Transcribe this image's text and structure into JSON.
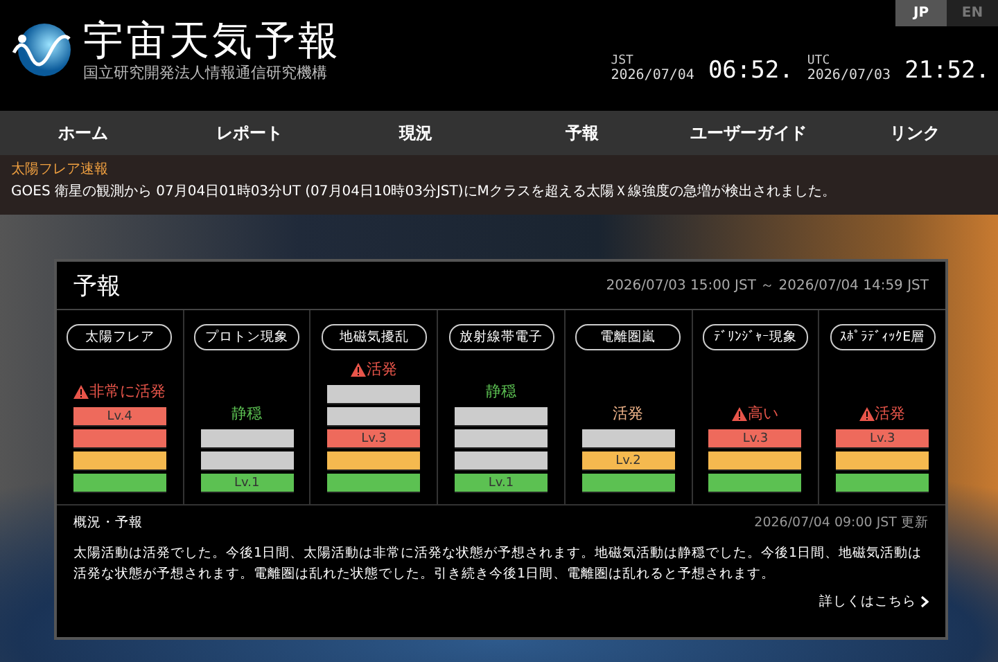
{
  "header": {
    "title": "宇宙天気予報",
    "subtitle": "国立研究開発法人情報通信研究機構",
    "languages": [
      {
        "label": "JP",
        "selected": true
      },
      {
        "label": "EN",
        "selected": false
      }
    ],
    "clocks": [
      {
        "zone": "JST",
        "date": "2026/07/04",
        "time": "06:52."
      },
      {
        "zone": "UTC",
        "date": "2026/07/03",
        "time": "21:52."
      }
    ]
  },
  "nav": [
    "ホーム",
    "レポート",
    "現況",
    "予報",
    "ユーザーガイド",
    "リンク"
  ],
  "alert": {
    "title": "太陽フレア速報",
    "message": "GOES 衛星の観測から 07月04日01時03分UT (07月04日10時03分JST)にMクラスを超える太陽Ｘ線強度の急増が検出されました。"
  },
  "forecast": {
    "title": "予報",
    "period": "2026/07/03 15:00 JST ～ 2026/07/04 14:59 JST",
    "categories": [
      {
        "name": "太陽フレア",
        "status": "非常に活発",
        "warning": true,
        "color": "#e8554a",
        "segments": [
          {
            "color": "#ee6a5c",
            "label": "Lv.4"
          },
          {
            "color": "#ee6a5c"
          },
          {
            "color": "#f5b94f"
          },
          {
            "color": "#5cc152"
          }
        ]
      },
      {
        "name": "プロトン現象",
        "status": "静穏",
        "warning": false,
        "color": "#5cc152",
        "segments": [
          {
            "color": "#cccccc"
          },
          {
            "color": "#cccccc"
          },
          {
            "color": "#5cc152",
            "label": "Lv.1"
          }
        ]
      },
      {
        "name": "地磁気擾乱",
        "status": "活発",
        "warning": true,
        "color": "#e8554a",
        "segments": [
          {
            "color": "#cccccc"
          },
          {
            "color": "#cccccc"
          },
          {
            "color": "#ee6a5c",
            "label": "Lv.3"
          },
          {
            "color": "#f5b94f"
          },
          {
            "color": "#5cc152"
          }
        ]
      },
      {
        "name": "放射線帯電子",
        "status": "静穏",
        "warning": false,
        "color": "#5cc152",
        "segments": [
          {
            "color": "#cccccc"
          },
          {
            "color": "#cccccc"
          },
          {
            "color": "#cccccc"
          },
          {
            "color": "#5cc152",
            "label": "Lv.1"
          }
        ]
      },
      {
        "name": "電離圏嵐",
        "status": "活発",
        "warning": false,
        "color": "#f0b48a",
        "segments": [
          {
            "color": "#cccccc"
          },
          {
            "color": "#f5b94f",
            "label": "Lv.2"
          },
          {
            "color": "#5cc152"
          }
        ]
      },
      {
        "name": "ﾃﾞﾘﾝｼﾞｬｰ現象",
        "status": "高い",
        "warning": true,
        "color": "#e8554a",
        "segments": [
          {
            "color": "#ee6a5c",
            "label": "Lv.3"
          },
          {
            "color": "#f5b94f"
          },
          {
            "color": "#5cc152"
          }
        ]
      },
      {
        "name": "ｽﾎﾟﾗﾃﾞｨｯｸE層",
        "status": "活発",
        "warning": true,
        "color": "#e8554a",
        "segments": [
          {
            "color": "#ee6a5c",
            "label": "Lv.3"
          },
          {
            "color": "#f5b94f"
          },
          {
            "color": "#5cc152"
          }
        ]
      }
    ],
    "summary": {
      "heading": "概況・予報",
      "updated": "2026/07/04 09:00 JST 更新",
      "text": "太陽活動は活発でした。今後1日間、太陽活動は非常に活発な状態が予想されます。地磁気活動は静穏でした。今後1日間、地磁気活動は活発な状態が予想されます。電離圏は乱れた状態でした。引き続き今後1日間、電離圏は乱れると予想されます。",
      "link": "詳しくはこちら"
    }
  }
}
